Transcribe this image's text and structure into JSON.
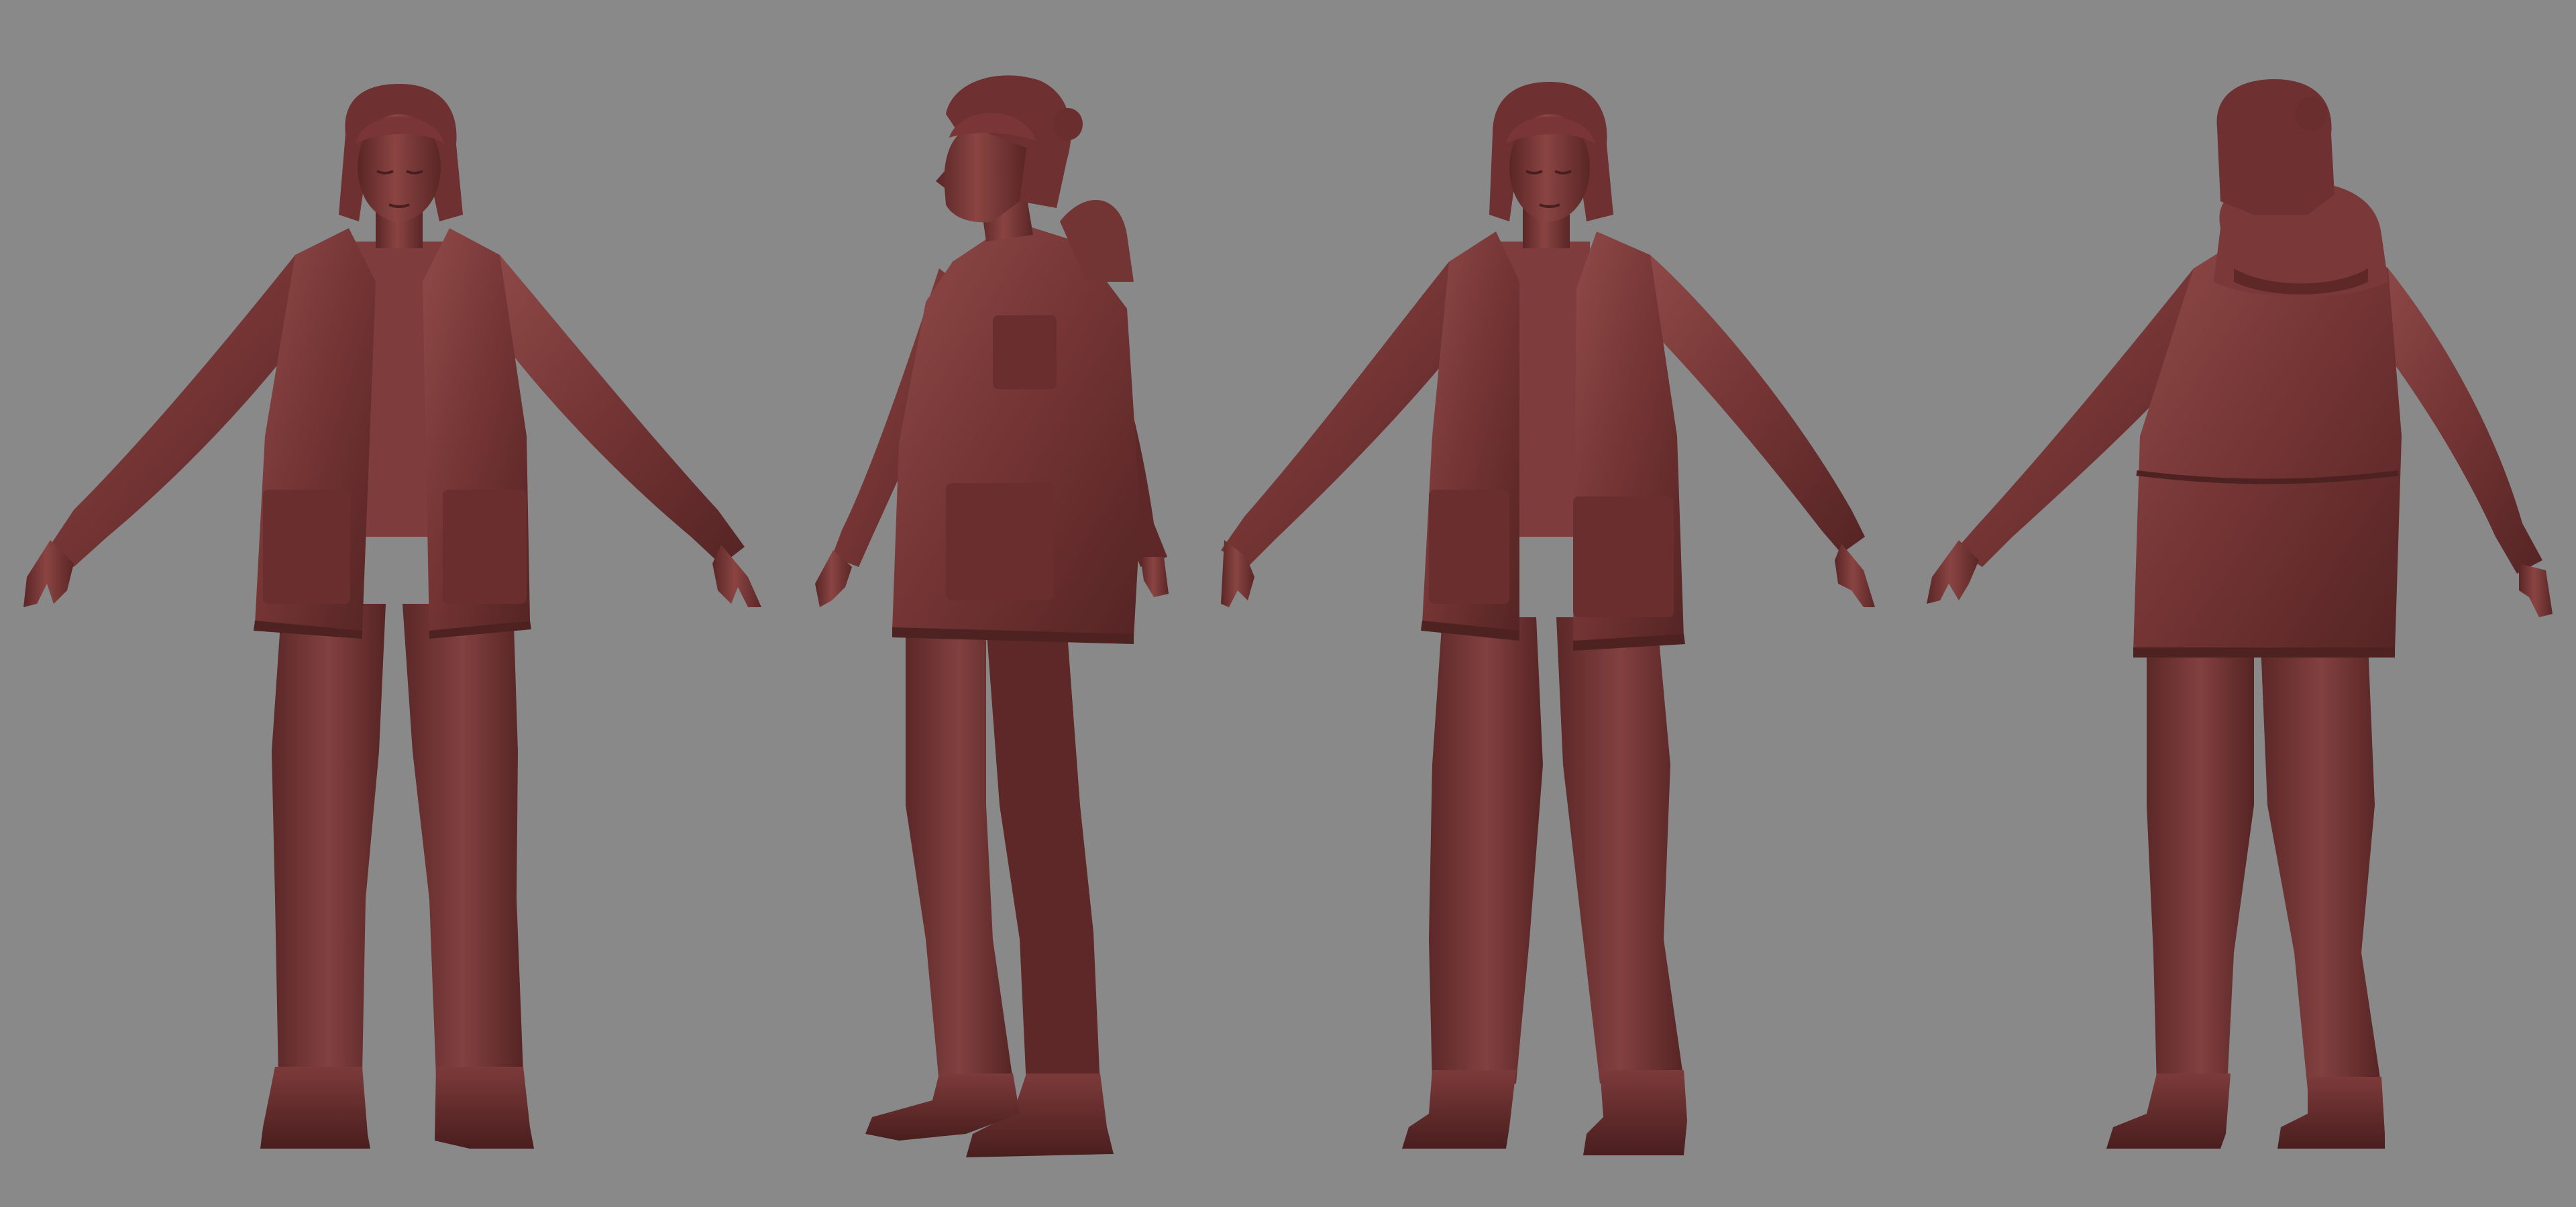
{
  "scene": {
    "background_color": "#898989",
    "model_colors": {
      "base": "#7a3838",
      "shadow": "#4f2222",
      "highlight": "#a25a58",
      "deep": "#3c1818"
    },
    "figures": [
      {
        "view": "front"
      },
      {
        "view": "left-profile"
      },
      {
        "view": "three-quarter-front"
      },
      {
        "view": "back"
      }
    ]
  }
}
